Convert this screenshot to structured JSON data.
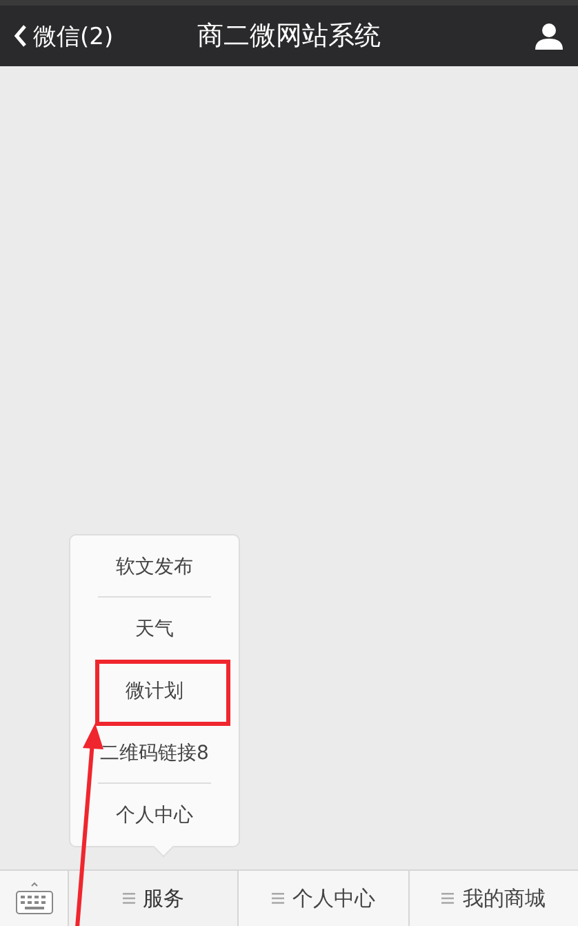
{
  "header": {
    "back_label": "微信(2)",
    "title": "商二微网站系统"
  },
  "popup_menu": [
    {
      "label": "软文发布",
      "divider": true,
      "highlighted": false
    },
    {
      "label": "天气",
      "divider": false,
      "highlighted": false
    },
    {
      "label": "微计划",
      "divider": false,
      "highlighted": true
    },
    {
      "label": "二维码链接8",
      "divider": true,
      "highlighted": false
    },
    {
      "label": "个人中心",
      "divider": false,
      "highlighted": false
    }
  ],
  "bottom_menu": [
    {
      "label": "服务",
      "selected": true
    },
    {
      "label": "个人中心",
      "selected": false
    },
    {
      "label": "我的商城",
      "selected": false
    }
  ]
}
